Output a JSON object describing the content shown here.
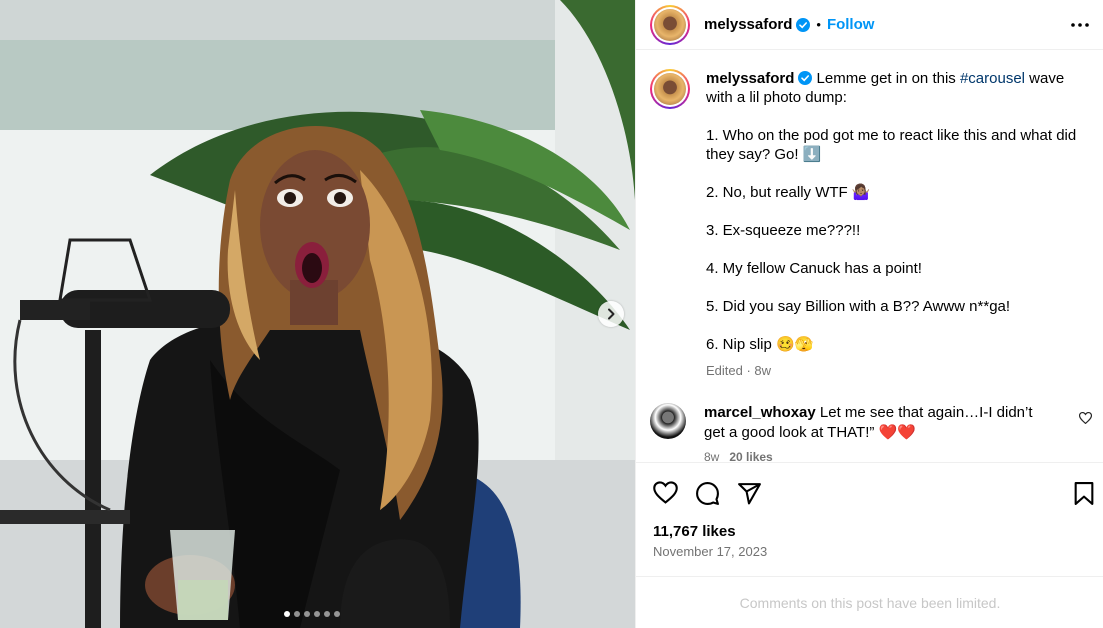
{
  "post": {
    "author": "melyssaford",
    "follow_label": "Follow",
    "separator": "•",
    "caption_prefix": "Lemme get in on this ",
    "hashtag": "#carousel",
    "caption_suffix": " wave with a lil photo dump:\n\n1. Who on the pod got me to react like this and what did they say? Go! ⬇️\n\n2. No, but really WTF 🤷🏽‍♀️\n\n3. Ex-squeeze me???!!\n\n4. My fellow Canuck has a point!\n\n5. Did you say Billion with a B?? Awww n**ga!\n\n6. Nip slip 🥴🫣",
    "edited_meta": "Edited · 8w",
    "likes": "11,767 likes",
    "date": "November 17, 2023",
    "comments_limited": "Comments on this post have been limited."
  },
  "comment": {
    "author": "marcel_whoxay",
    "text": "Let me see that again…I-I didn’t get a good look at THAT!” ❤️❤️",
    "age": "8w",
    "likes": "20 likes"
  },
  "carousel": {
    "slide_count": 6,
    "active_index": 0
  },
  "colors": {
    "link": "#0095f6",
    "hashtag": "#00376b",
    "muted": "#737373",
    "verified": "#0095f6"
  },
  "icons": [
    "more-options-icon",
    "heart-icon",
    "comment-icon",
    "share-icon",
    "bookmark-icon",
    "verified-badge-icon",
    "chevron-right-icon"
  ]
}
